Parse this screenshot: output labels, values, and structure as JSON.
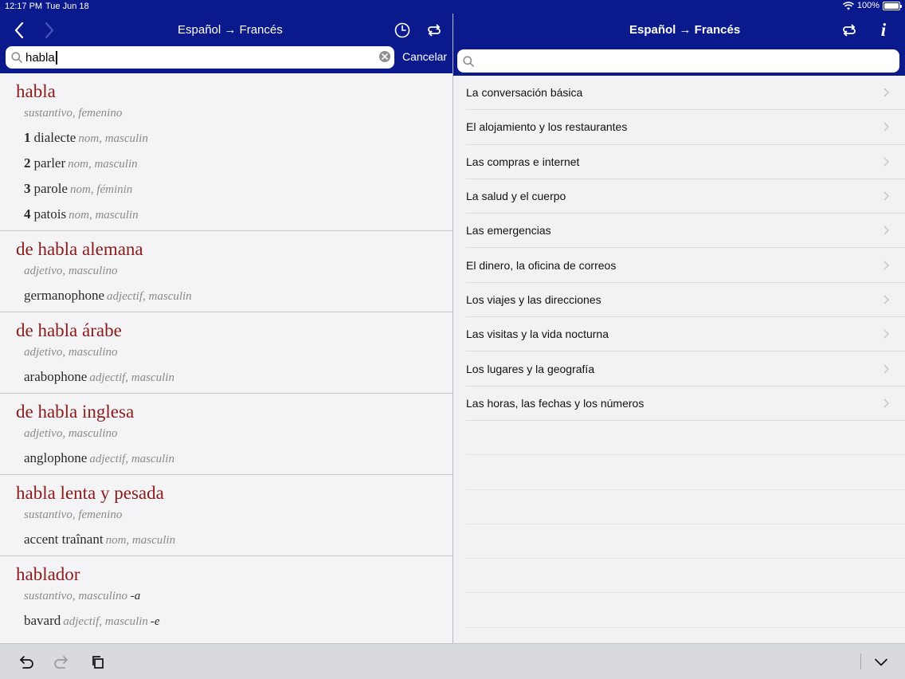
{
  "status": {
    "time": "12:17 PM",
    "date": "Tue Jun 18",
    "battery": "100%"
  },
  "left_header": {
    "title": "Español → Francés"
  },
  "search": {
    "value": "habla",
    "cancel_label": "Cancelar"
  },
  "right_header": {
    "title": "Español → Francés"
  },
  "right_search": {
    "placeholder": ""
  },
  "results": [
    {
      "headword": "habla",
      "pos": "sustantivo, femenino",
      "senses": [
        {
          "num": "1",
          "text": "dialecte",
          "gram": "nom, masculin"
        },
        {
          "num": "2",
          "text": "parler",
          "gram": "nom, masculin"
        },
        {
          "num": "3",
          "text": "parole",
          "gram": "nom, féminin"
        },
        {
          "num": "4",
          "text": "patois",
          "gram": "nom, masculin"
        }
      ]
    },
    {
      "headword": "de habla alemana",
      "pos": "adjetivo, masculino",
      "senses": [
        {
          "num": "",
          "text": "germanophone",
          "gram": "adjectif, masculin"
        }
      ]
    },
    {
      "headword": "de habla árabe",
      "pos": "adjetivo, masculino",
      "senses": [
        {
          "num": "",
          "text": "arabophone",
          "gram": "adjectif, masculin"
        }
      ]
    },
    {
      "headword": "de habla inglesa",
      "pos": "adjetivo, masculino",
      "senses": [
        {
          "num": "",
          "text": "anglophone",
          "gram": "adjectif, masculin"
        }
      ]
    },
    {
      "headword": "habla lenta y pesada",
      "pos": "sustantivo, femenino",
      "senses": [
        {
          "num": "",
          "text": "accent traînant",
          "gram": "nom, masculin"
        }
      ]
    },
    {
      "headword": "hablador",
      "pos_main": "sustantivo, masculino",
      "pos_suffix": "-a",
      "senses": [
        {
          "num": "",
          "text": "bavard",
          "gram": "adjectif, masculin",
          "suffix": "-e"
        }
      ]
    }
  ],
  "topics": [
    "La conversación básica",
    "El alojamiento y los restaurantes",
    "Las compras e internet",
    "La salud y el cuerpo",
    "Las emergencias",
    "El dinero, la oficina de correos",
    "Los viajes y las direcciones",
    "Las visitas y la vida nocturna",
    "Los lugares y la geografía",
    "Las horas, las fechas y los números"
  ],
  "icons": {
    "back": "chevron-left-icon",
    "forward": "chevron-right-icon",
    "history": "clock-icon",
    "swap": "swap-icon",
    "info": "info-icon",
    "undo": "undo-icon",
    "redo": "redo-icon",
    "copy": "copy-icon",
    "collapse": "chevron-down-icon"
  },
  "colors": {
    "header": "#0a1a8c",
    "headword": "#8b1a1a",
    "grammar": "#8a8a8a"
  }
}
